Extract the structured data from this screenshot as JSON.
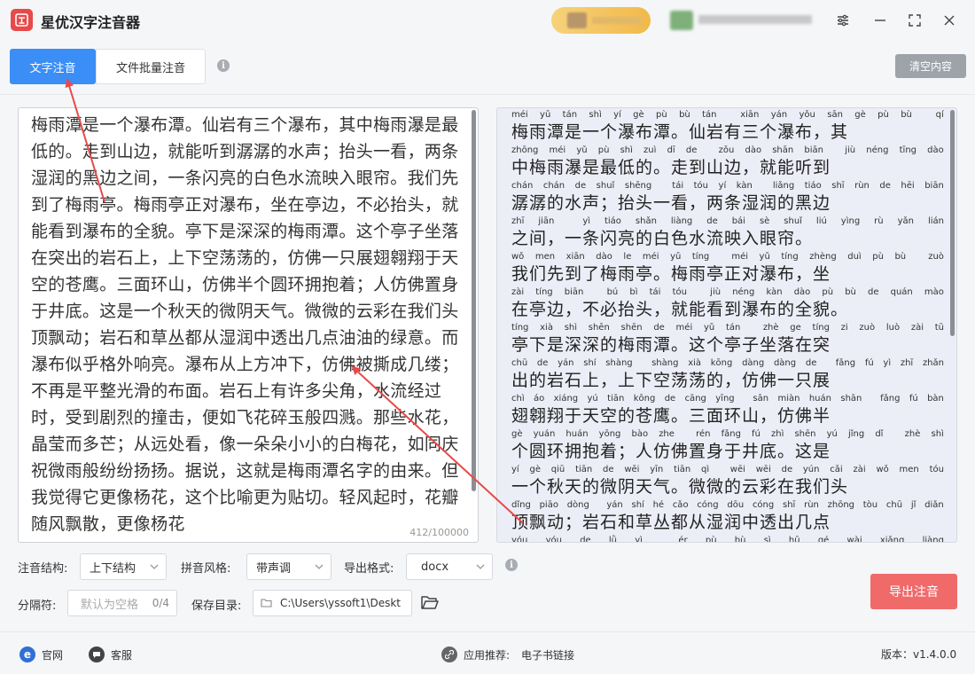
{
  "app": {
    "title": "星优汉字注音器"
  },
  "tabs": [
    {
      "label": "文字注音"
    },
    {
      "label": "文件批量注音"
    }
  ],
  "toolbar": {
    "clear_label": "清空内容"
  },
  "editor": {
    "text": "梅雨潭是一个瀑布潭。仙岩有三个瀑布，其中梅雨瀑是最低的。走到山边，就能听到潺潺的水声；抬头一看，两条湿润的黑边之间，一条闪亮的白色水流映入眼帘。我们先到了梅雨亭。梅雨亭正对瀑布，坐在亭边，不必抬头，就能看到瀑布的全貌。亭下是深深的梅雨潭。这个亭子坐落在突出的岩石上，上下空荡荡的，仿佛一只展翅翱翔于天空的苍鹰。三面环山，仿佛半个圆环拥抱着；人仿佛置身于井底。这是一个秋天的微阴天气。微微的云彩在我们头顶飘动；岩石和草丛都从湿润中透出几点油油的绿意。而瀑布似乎格外响亮。瀑布从上方冲下，仿佛被撕成几缕；不再是平整光滑的布面。岩石上有许多尖角，水流经过时，受到剧烈的撞击，便如飞花碎玉般四溅。那些水花，晶莹而多芒；从远处看，像一朵朵小小的白梅花，如同庆祝微雨般纷纷扬扬。据说，这就是梅雨潭名字的由来。但我觉得它更像杨花，这个比喻更为贴切。轻风起时，花瓣随风飘散，更像杨花",
    "char_count": "412/100000"
  },
  "preview": {
    "lines": [
      {
        "py": [
          "méi",
          "yǔ",
          "tán",
          "shì",
          "yí",
          "gè",
          "pù",
          "bù",
          "tán",
          "",
          "xiān",
          "yán",
          "yǒu",
          "sān",
          "gè",
          "pù",
          "bù",
          "",
          "qí"
        ],
        "hz": "梅雨潭是一个瀑布潭。仙岩有三个瀑布，其"
      },
      {
        "py": [
          "zhōng",
          "méi",
          "yǔ",
          "pù",
          "shì",
          "zuì",
          "dī",
          "de",
          "",
          "zǒu",
          "dào",
          "shān",
          "biān",
          "",
          "jiù",
          "néng",
          "tīng",
          "dào"
        ],
        "hz": "中梅雨瀑是最低的。走到山边，就能听到"
      },
      {
        "py": [
          "chán",
          "chán",
          "de",
          "shuǐ",
          "shēng",
          "",
          "tái",
          "tóu",
          "yí",
          "kàn",
          "",
          "liǎng",
          "tiáo",
          "shī",
          "rùn",
          "de",
          "hēi",
          "biān"
        ],
        "hz": "潺潺的水声；抬头一看，两条湿润的黑边"
      },
      {
        "py": [
          "zhī",
          "jiān",
          "",
          "yì",
          "tiáo",
          "shǎn",
          "liàng",
          "de",
          "bái",
          "sè",
          "shuǐ",
          "liú",
          "yìng",
          "rù",
          "yǎn",
          "lián"
        ],
        "hz": "之间，一条闪亮的白色水流映入眼帘。"
      },
      {
        "py": [
          "wǒ",
          "men",
          "xiān",
          "dào",
          "le",
          "méi",
          "yǔ",
          "tíng",
          "",
          "méi",
          "yǔ",
          "tíng",
          "zhèng",
          "duì",
          "pù",
          "bù",
          "",
          "zuò"
        ],
        "hz": "我们先到了梅雨亭。梅雨亭正对瀑布，坐"
      },
      {
        "py": [
          "zài",
          "tíng",
          "biān",
          "",
          "bú",
          "bì",
          "tái",
          "tóu",
          "",
          "jiù",
          "néng",
          "kàn",
          "dào",
          "pù",
          "bù",
          "de",
          "quán",
          "mào"
        ],
        "hz": "在亭边，不必抬头，就能看到瀑布的全貌。"
      },
      {
        "py": [
          "tíng",
          "xià",
          "shì",
          "shēn",
          "shēn",
          "de",
          "méi",
          "yǔ",
          "tán",
          "",
          "zhè",
          "ge",
          "tíng",
          "zi",
          "zuò",
          "luò",
          "zài",
          "tū"
        ],
        "hz": "亭下是深深的梅雨潭。这个亭子坐落在突"
      },
      {
        "py": [
          "chū",
          "de",
          "yán",
          "shí",
          "shàng",
          "",
          "shàng",
          "xià",
          "kōng",
          "dàng",
          "dàng",
          "de",
          "",
          "fǎng",
          "fú",
          "yì",
          "zhī",
          "zhǎn"
        ],
        "hz": "出的岩石上，上下空荡荡的，仿佛一只展"
      },
      {
        "py": [
          "chì",
          "áo",
          "xiáng",
          "yú",
          "tiān",
          "kōng",
          "de",
          "cāng",
          "yīng",
          "",
          "sān",
          "miàn",
          "huán",
          "shān",
          "",
          "fǎng",
          "fú",
          "bàn"
        ],
        "hz": "翅翱翔于天空的苍鹰。三面环山，仿佛半"
      },
      {
        "py": [
          "gè",
          "yuán",
          "huán",
          "yōng",
          "bào",
          "zhe",
          "",
          "rén",
          "fǎng",
          "fú",
          "zhì",
          "shēn",
          "yú",
          "jǐng",
          "dǐ",
          "",
          "zhè",
          "shì"
        ],
        "hz": "个圆环拥抱着；人仿佛置身于井底。这是"
      },
      {
        "py": [
          "yí",
          "gè",
          "qiū",
          "tiān",
          "de",
          "wēi",
          "yīn",
          "tiān",
          "qì",
          "",
          "wēi",
          "wēi",
          "de",
          "yún",
          "cǎi",
          "zài",
          "wǒ",
          "men",
          "tóu"
        ],
        "hz": "一个秋天的微阴天气。微微的云彩在我们头"
      },
      {
        "py": [
          "dǐng",
          "piāo",
          "dòng",
          "",
          "yán",
          "shí",
          "hé",
          "cǎo",
          "cóng",
          "dōu",
          "cóng",
          "shī",
          "rùn",
          "zhōng",
          "tòu",
          "chū",
          "jǐ",
          "diǎn"
        ],
        "hz": "顶飘动；岩石和草丛都从湿润中透出几点"
      },
      {
        "py": [
          "yóu",
          "yóu",
          "de",
          "lǜ",
          "yì",
          "",
          "ér",
          "pù",
          "bù",
          "sì",
          "hū",
          "gé",
          "wài",
          "xiǎng",
          "liàng"
        ],
        "hz": ""
      }
    ]
  },
  "options": {
    "structure": {
      "label": "注音结构:",
      "value": "上下结构"
    },
    "style": {
      "label": "拼音风格:",
      "value": "带声调"
    },
    "format": {
      "label": "导出格式:",
      "value": "docx"
    },
    "separator": {
      "label": "分隔符:",
      "placeholder": "默认为空格",
      "count": "0/4"
    },
    "save_dir": {
      "label": "保存目录:",
      "value": "C:\\Users\\yssoft1\\Deskt"
    },
    "export_label": "导出注音"
  },
  "footer": {
    "website": "官网",
    "support": "客服",
    "recommend_label": "应用推荐:",
    "recommend_link": "电子书链接",
    "version": "版本：v1.4.0.0"
  },
  "colors": {
    "accent": "#3a8ef6",
    "export": "#f06a6a",
    "arrow": "#e84a4a"
  }
}
